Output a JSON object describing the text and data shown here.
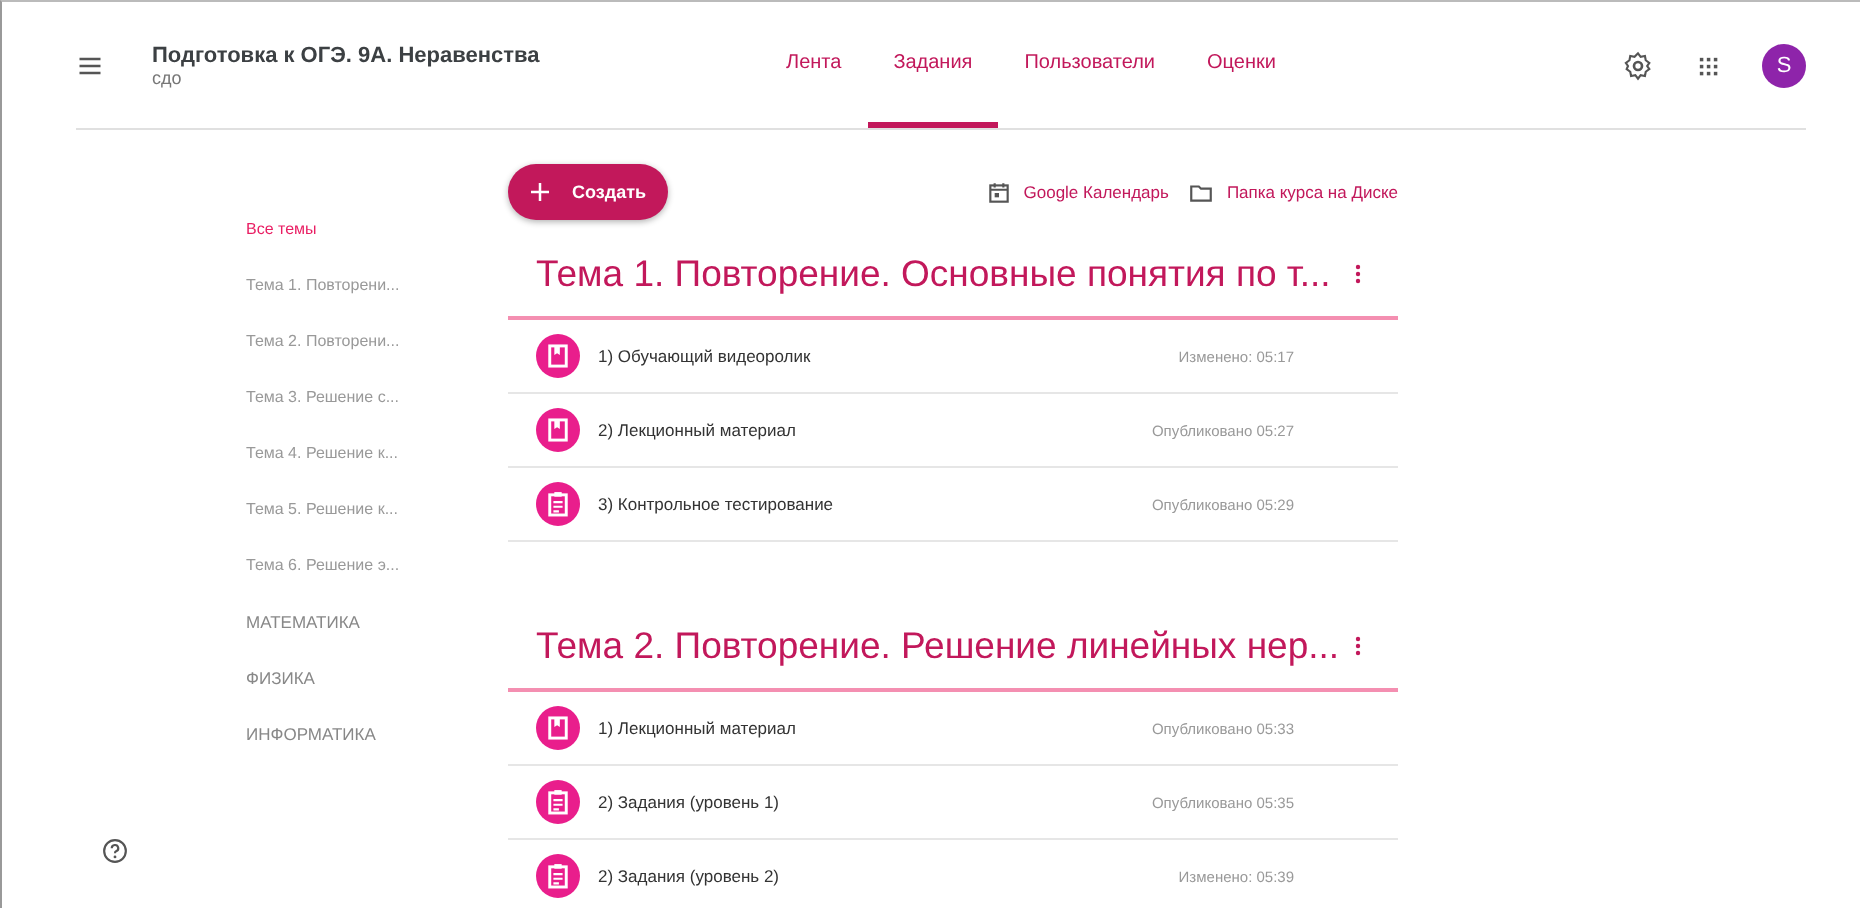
{
  "header": {
    "title": "Подготовка к ОГЭ. 9А. Неравенства",
    "subtitle": "сдо",
    "avatar": "S"
  },
  "tabs": [
    {
      "label": "Лента",
      "selected": false
    },
    {
      "label": "Задания",
      "selected": true
    },
    {
      "label": "Пользователи",
      "selected": false
    },
    {
      "label": "Оценки",
      "selected": false
    }
  ],
  "toolbar": {
    "create": "Создать",
    "links": [
      {
        "kind": "calendar",
        "label": "Google Календарь"
      },
      {
        "kind": "folder",
        "label": "Папка курса на Диске"
      }
    ]
  },
  "sidebar": {
    "items": [
      {
        "label": "Все темы",
        "selected": true
      },
      {
        "label": "Тема 1. Повторени...",
        "selected": false
      },
      {
        "label": "Тема 2. Повторени...",
        "selected": false
      },
      {
        "label": "Тема 3. Решение с...",
        "selected": false
      },
      {
        "label": "Тема 4. Решение к...",
        "selected": false
      },
      {
        "label": "Тема 5. Решение к...",
        "selected": false
      },
      {
        "label": "Тема 6. Решение э...",
        "selected": false
      },
      {
        "label": "МАТЕМАТИКА",
        "selected": false
      },
      {
        "label": "ФИЗИКА",
        "selected": false
      },
      {
        "label": "ИНФОРМАТИКА",
        "selected": false
      }
    ]
  },
  "topics": [
    {
      "title": "Тема 1. Повторение. Основные понятия по т...",
      "items": [
        {
          "kind": "material",
          "title": "1) Обучающий видеоролик",
          "status": "Изменено: 05:17"
        },
        {
          "kind": "material",
          "title": "2) Лекционный материал",
          "status": "Опубликовано 05:27"
        },
        {
          "kind": "assignment",
          "title": "3) Контрольное тестирование",
          "status": "Опубликовано 05:29"
        }
      ]
    },
    {
      "title": "Тема 2. Повторение. Решение линейных нер...",
      "items": [
        {
          "kind": "material",
          "title": "1) Лекционный материал",
          "status": "Опубликовано 05:33"
        },
        {
          "kind": "assignment",
          "title": "2) Задания (уровень 1)",
          "status": "Опубликовано 05:35"
        },
        {
          "kind": "assignment",
          "title": "2) Задания (уровень 2)",
          "status": "Изменено: 05:39"
        }
      ]
    }
  ]
}
